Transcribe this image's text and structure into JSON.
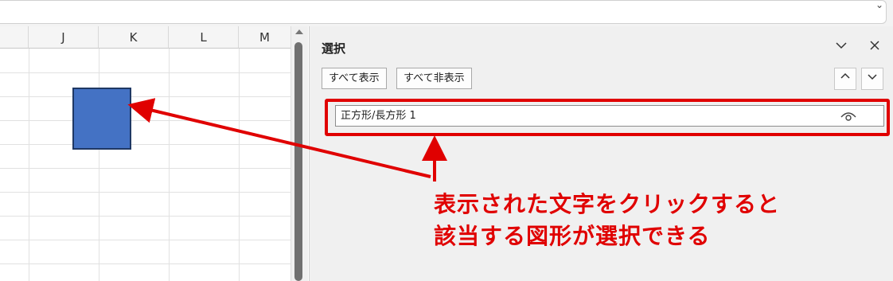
{
  "sheet": {
    "columns": [
      "J",
      "K",
      "L",
      "M"
    ]
  },
  "selection_pane": {
    "title": "選択",
    "show_all_label": "すべて表示",
    "hide_all_label": "すべて非表示",
    "items": [
      {
        "label": "正方形/長方形 1"
      }
    ]
  },
  "annotation": {
    "line1": "表示された文字をクリックすると",
    "line2": "該当する図形が選択できる",
    "color": "#e00000"
  },
  "colors": {
    "shape_fill": "#4472c4",
    "shape_border": "#1f3864",
    "pane_bg": "#f0f0f0"
  }
}
